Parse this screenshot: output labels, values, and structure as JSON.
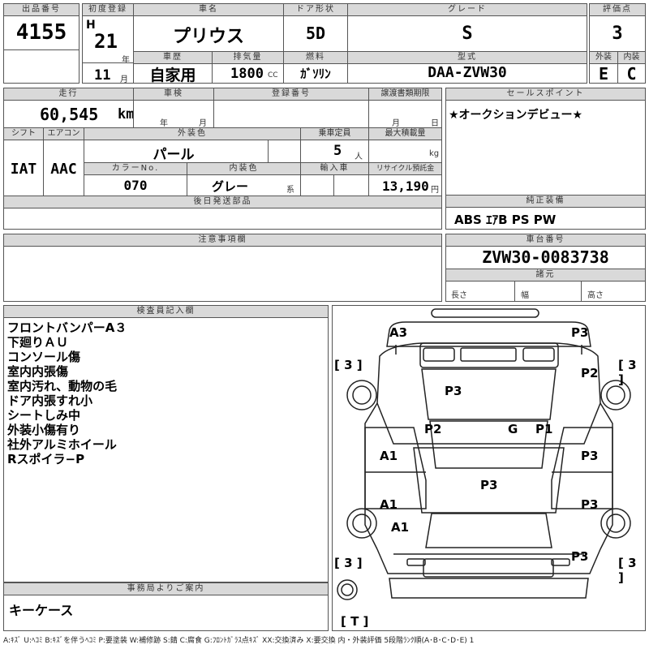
{
  "header_labels": {
    "lot_no": "出品番号",
    "first_reg": "初度登録",
    "model_name": "車名",
    "door": "ドア形状",
    "grade": "グレード",
    "score": "評価点",
    "car_history": "車歴",
    "displacement": "排気量",
    "fuel": "燃料",
    "model_code": "型式",
    "exterior": "外装",
    "interior": "内装",
    "mileage": "走行",
    "inspection": "車検",
    "reg_no": "登録番号",
    "transfer_deadline": "譲渡書類期限",
    "sales_point": "セールスポイント",
    "shift": "シフト",
    "aircon": "エアコン",
    "ext_color": "外装色",
    "capacity": "乗車定員",
    "max_load": "最大積載量",
    "color_no": "カラーNo.",
    "int_color": "内装色",
    "import": "輸入車",
    "recycle": "リサイクル預託金",
    "later_parts": "後日発送部品",
    "genuine_equip": "純正装備",
    "caution": "注意事項欄",
    "chassis_no": "車台番号",
    "specs": "諸元",
    "inspector_notes": "検査員記入欄",
    "office_info": "事務局よりご案内"
  },
  "vehicle": {
    "lot_no": "4155",
    "era": "H",
    "year": "21",
    "year_unit": "年",
    "month": "11",
    "month_unit": "月",
    "model_name": "プリウス",
    "door": "5D",
    "grade": "S",
    "score": "3",
    "car_history": "自家用",
    "displacement": "1800",
    "displacement_unit": "CC",
    "fuel": "ｶﾞｿﾘﾝ",
    "model_code": "DAA-ZVW30",
    "exterior_grade": "E",
    "interior_grade": "C",
    "mileage": "60,545",
    "mileage_unit": "km",
    "inspection_year_unit": "年",
    "inspection_month_unit": "月",
    "deadline_month_unit": "月",
    "deadline_day_unit": "日",
    "sales_point": "★オークションデビュー★",
    "shift": "IAT",
    "aircon": "AAC",
    "ext_color": "パール",
    "capacity": "5",
    "capacity_unit": "人",
    "max_load_unit": "kg",
    "color_no": "070",
    "int_color": "グレー",
    "int_color_unit": "系",
    "recycle": "13,190",
    "recycle_unit": "円",
    "genuine_equip": "ABS ｴｱB PS PW",
    "chassis_no": "ZVW30-0083738",
    "length_label": "長さ",
    "width_label": "幅",
    "height_label": "高さ"
  },
  "inspector_notes": [
    "フロントバンパーA３",
    "下廻りＡＵ",
    "コンソール傷",
    "室内内張傷",
    "室内汚れ、動物の毛",
    "ドア内張すれ小",
    "シートしみ中",
    "外装小傷有り",
    "社外アルミホイール",
    "Rスポイラ−P"
  ],
  "office_notes": "キーケース",
  "diagram_marks": {
    "front_left": "A3",
    "front_right": "P3",
    "tire_fl": "[ 3 ]",
    "tire_fr": "[ 3 ]",
    "fender_r": "P2",
    "hood": "P3",
    "a_left": "P2",
    "roof": "G",
    "a_right": "P1",
    "door_fl": "A1",
    "door_fr": "P3",
    "roof_center": "P3",
    "door_rl": "A1",
    "door_rr": "P3",
    "quarter_l": "A1",
    "rear_right": "P3",
    "tire_rl": "[ 3 ]",
    "tire_rr": "[ 3 ]",
    "spare": "[ T ]"
  },
  "legend": "A:ｷｽﾞ U:ﾍｺﾐ B:ｷｽﾞを伴うﾍｺﾐ P:要塗装 W:補修跡 S:錆 C:腐食 G:ﾌﾛﾝﾄｶﾞﾗｽ点ｷｽﾞ XX:交換済み X:要交換 内・外装評価 5段階ﾗﾝｸ順(A･B･C･D･E) 1"
}
